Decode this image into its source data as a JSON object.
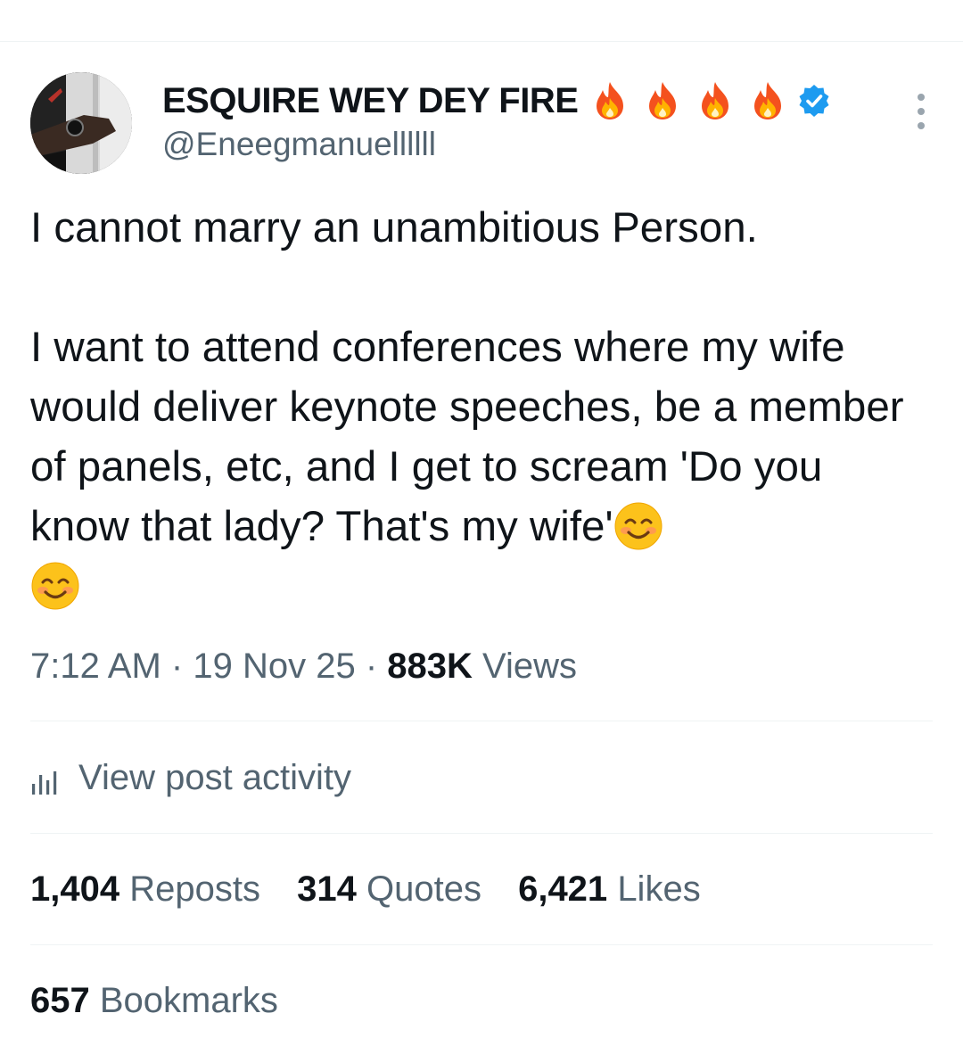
{
  "post": {
    "author": {
      "display_name": "ESQUIRE WEY DEY FIRE",
      "handle": "@Eneegmanuellllll",
      "verified": true,
      "name_emojis": [
        "fire-emoji",
        "fire-emoji",
        "fire-emoji",
        "fire-emoji"
      ]
    },
    "text_line1": "I cannot marry an unambitious Person.",
    "text_line2": "I want to attend conferences where my wife would deliver keynote speeches, be a member of panels, etc, and I get to scream 'Do you know that lady? That's my wife'",
    "text_emojis": [
      "smiling-face-emoji",
      "smiling-face-emoji"
    ],
    "time": "7:12 AM",
    "date": "19 Nov 25",
    "separator": "·",
    "views_count": "883K",
    "views_label": "Views"
  },
  "activity": {
    "label": "View post activity",
    "icon": "chart-bars-icon"
  },
  "stats": {
    "reposts_count": "1,404",
    "reposts_label": "Reposts",
    "quotes_count": "314",
    "quotes_label": "Quotes",
    "likes_count": "6,421",
    "likes_label": "Likes",
    "bookmarks_count": "657",
    "bookmarks_label": "Bookmarks"
  },
  "colors": {
    "text_primary": "#0f1419",
    "text_secondary": "#536471",
    "verified_blue": "#1d9bf0",
    "divider": "#eff3f4"
  }
}
